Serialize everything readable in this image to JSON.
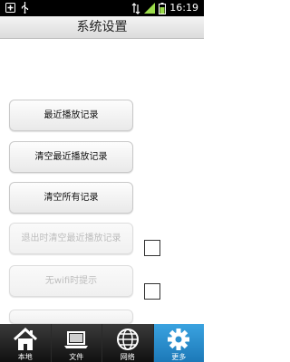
{
  "status_bar": {
    "time": "16:19",
    "battery_level": 0.7
  },
  "header": {
    "title": "系统设置"
  },
  "settings": {
    "recent_play_label": "最近播放记录",
    "clear_recent_label": "清空最近播放记录",
    "clear_all_label": "清空所有记录",
    "clear_on_exit_label": "退出时清空最近播放记录",
    "clear_on_exit_checked": false,
    "no_wifi_prompt_label": "无wifi时提示",
    "no_wifi_prompt_checked": false
  },
  "tabs": [
    {
      "label": "本地",
      "icon": "home-icon",
      "active": false
    },
    {
      "label": "文件",
      "icon": "laptop-icon",
      "active": false
    },
    {
      "label": "网络",
      "icon": "globe-icon",
      "active": false
    },
    {
      "label": "更多",
      "icon": "gear-icon",
      "active": true
    }
  ],
  "colors": {
    "active_tab": "#2a8fcf",
    "tabbar": "#1f1f1f",
    "status_bar": "#000000"
  }
}
